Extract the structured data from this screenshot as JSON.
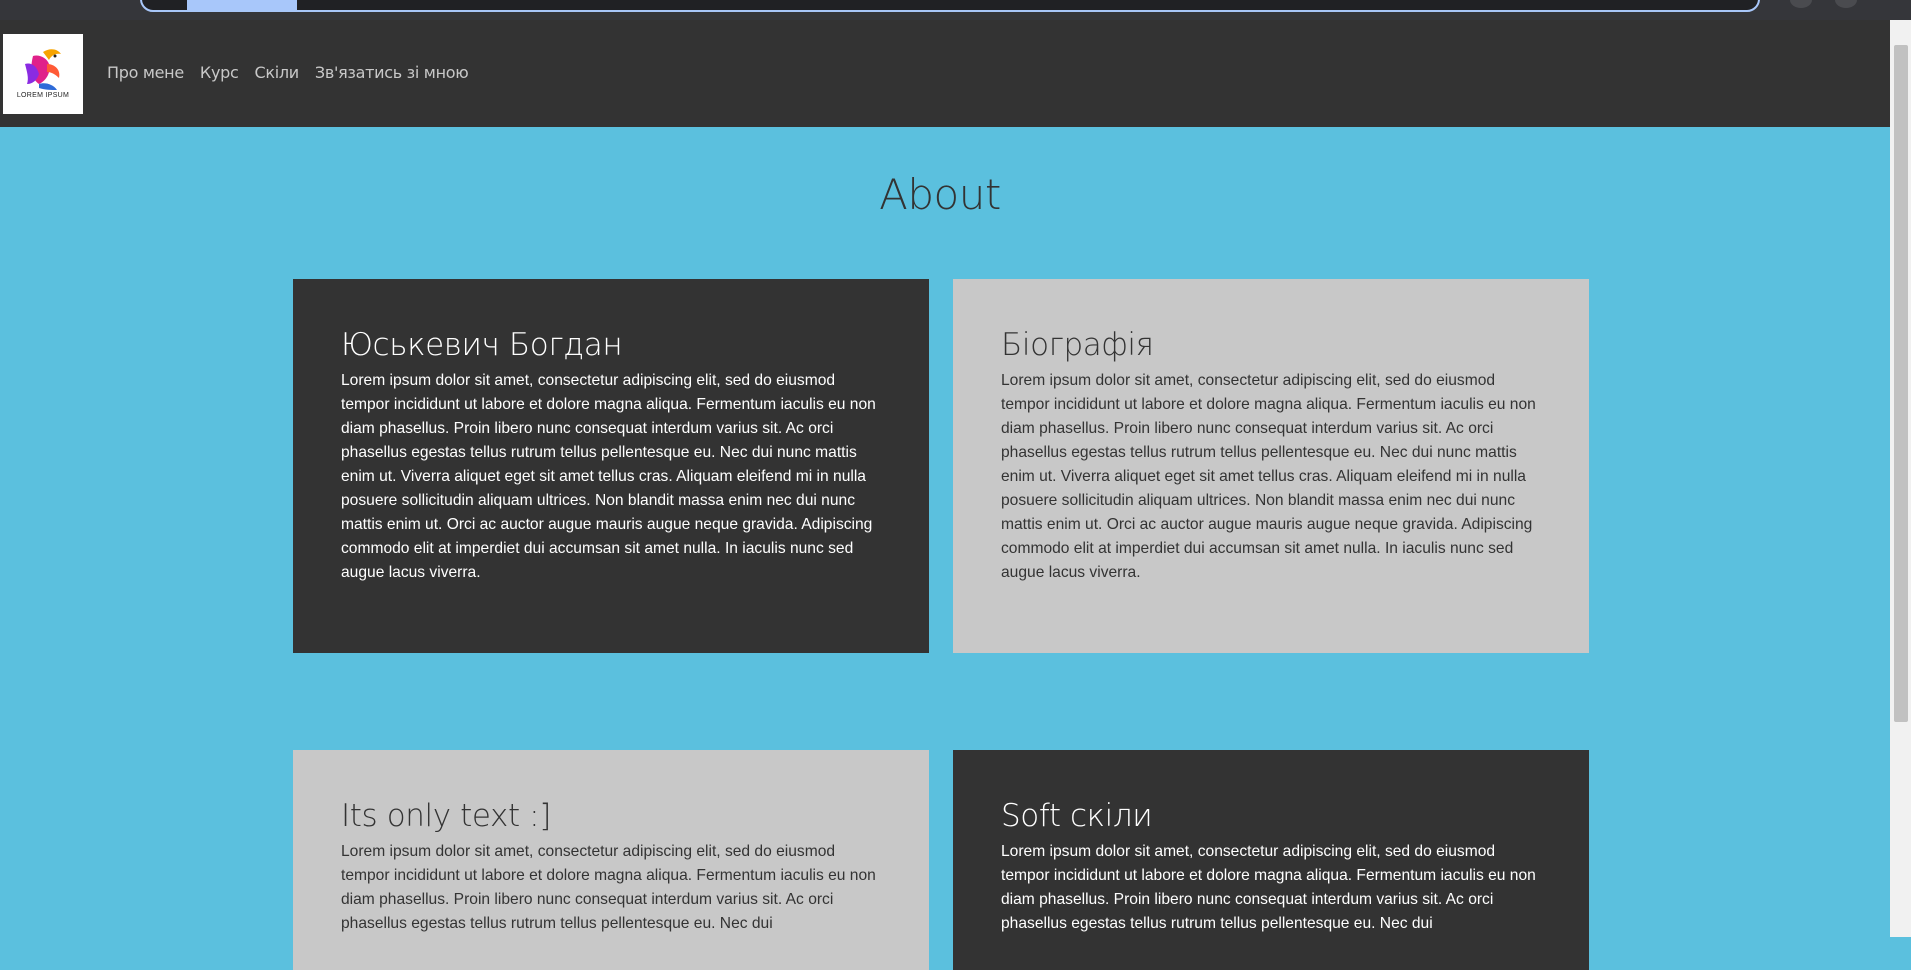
{
  "browser": {
    "icons": [
      "omnibox",
      "profile-avatar"
    ]
  },
  "navbar": {
    "logo": {
      "caption": "LOREM IPSUM",
      "icon": "bird-logo-icon",
      "colors": [
        "#e0218a",
        "#8a2be2",
        "#f7a400",
        "#2f6bd8"
      ]
    },
    "links": [
      {
        "label": "Про мене"
      },
      {
        "label": "Курс"
      },
      {
        "label": "Скіли"
      },
      {
        "label": "Зв'язатись зі мною"
      }
    ]
  },
  "main": {
    "title": "About",
    "cards": [
      {
        "heading": "Юськевич Богдан",
        "text": "Lorem ipsum dolor sit amet, consectetur adipiscing elit, sed do eiusmod tempor incididunt ut labore et dolore magna aliqua. Fermentum iaculis eu non diam phasellus. Proin libero nunc consequat interdum varius sit. Ac orci phasellus egestas tellus rutrum tellus pellentesque eu. Nec dui nunc mattis enim ut. Viverra aliquet eget sit amet tellus cras. Aliquam eleifend mi in nulla posuere sollicitudin aliquam ultrices. Non blandit massa enim nec dui nunc mattis enim ut. Orci ac auctor augue mauris augue neque gravida. Adipiscing commodo elit at imperdiet dui accumsan sit amet nulla. In iaculis nunc sed augue lacus viverra.",
        "theme": "dark"
      },
      {
        "heading": "Біографія",
        "text": "Lorem ipsum dolor sit amet, consectetur adipiscing elit, sed do eiusmod tempor incididunt ut labore et dolore magna aliqua. Fermentum iaculis eu non diam phasellus. Proin libero nunc consequat interdum varius sit. Ac orci phasellus egestas tellus rutrum tellus pellentesque eu. Nec dui nunc mattis enim ut. Viverra aliquet eget sit amet tellus cras. Aliquam eleifend mi in nulla posuere sollicitudin aliquam ultrices. Non blandit massa enim nec dui nunc mattis enim ut. Orci ac auctor augue mauris augue neque gravida. Adipiscing commodo elit at imperdiet dui accumsan sit amet nulla. In iaculis nunc sed augue lacus viverra.",
        "theme": "light"
      },
      {
        "heading": "Its only text :]",
        "text": "Lorem ipsum dolor sit amet, consectetur adipiscing elit, sed do eiusmod tempor incididunt ut labore et dolore magna aliqua. Fermentum iaculis eu non diam phasellus. Proin libero nunc consequat interdum varius sit. Ac orci phasellus egestas tellus rutrum tellus pellentesque eu. Nec dui",
        "theme": "light"
      },
      {
        "heading": "Soft скіли",
        "text": "Lorem ipsum dolor sit amet, consectetur adipiscing elit, sed do eiusmod tempor incididunt ut labore et dolore magna aliqua. Fermentum iaculis eu non diam phasellus. Proin libero nunc consequat interdum varius sit. Ac orci phasellus egestas tellus rutrum tellus pellentesque eu. Nec dui",
        "theme": "dark"
      }
    ]
  },
  "colors": {
    "page_background": "#5bc0de",
    "navbar_background": "#333333",
    "card_dark": "#333333",
    "card_light": "#c8c8c8",
    "nav_link": "#c8c8c8"
  }
}
